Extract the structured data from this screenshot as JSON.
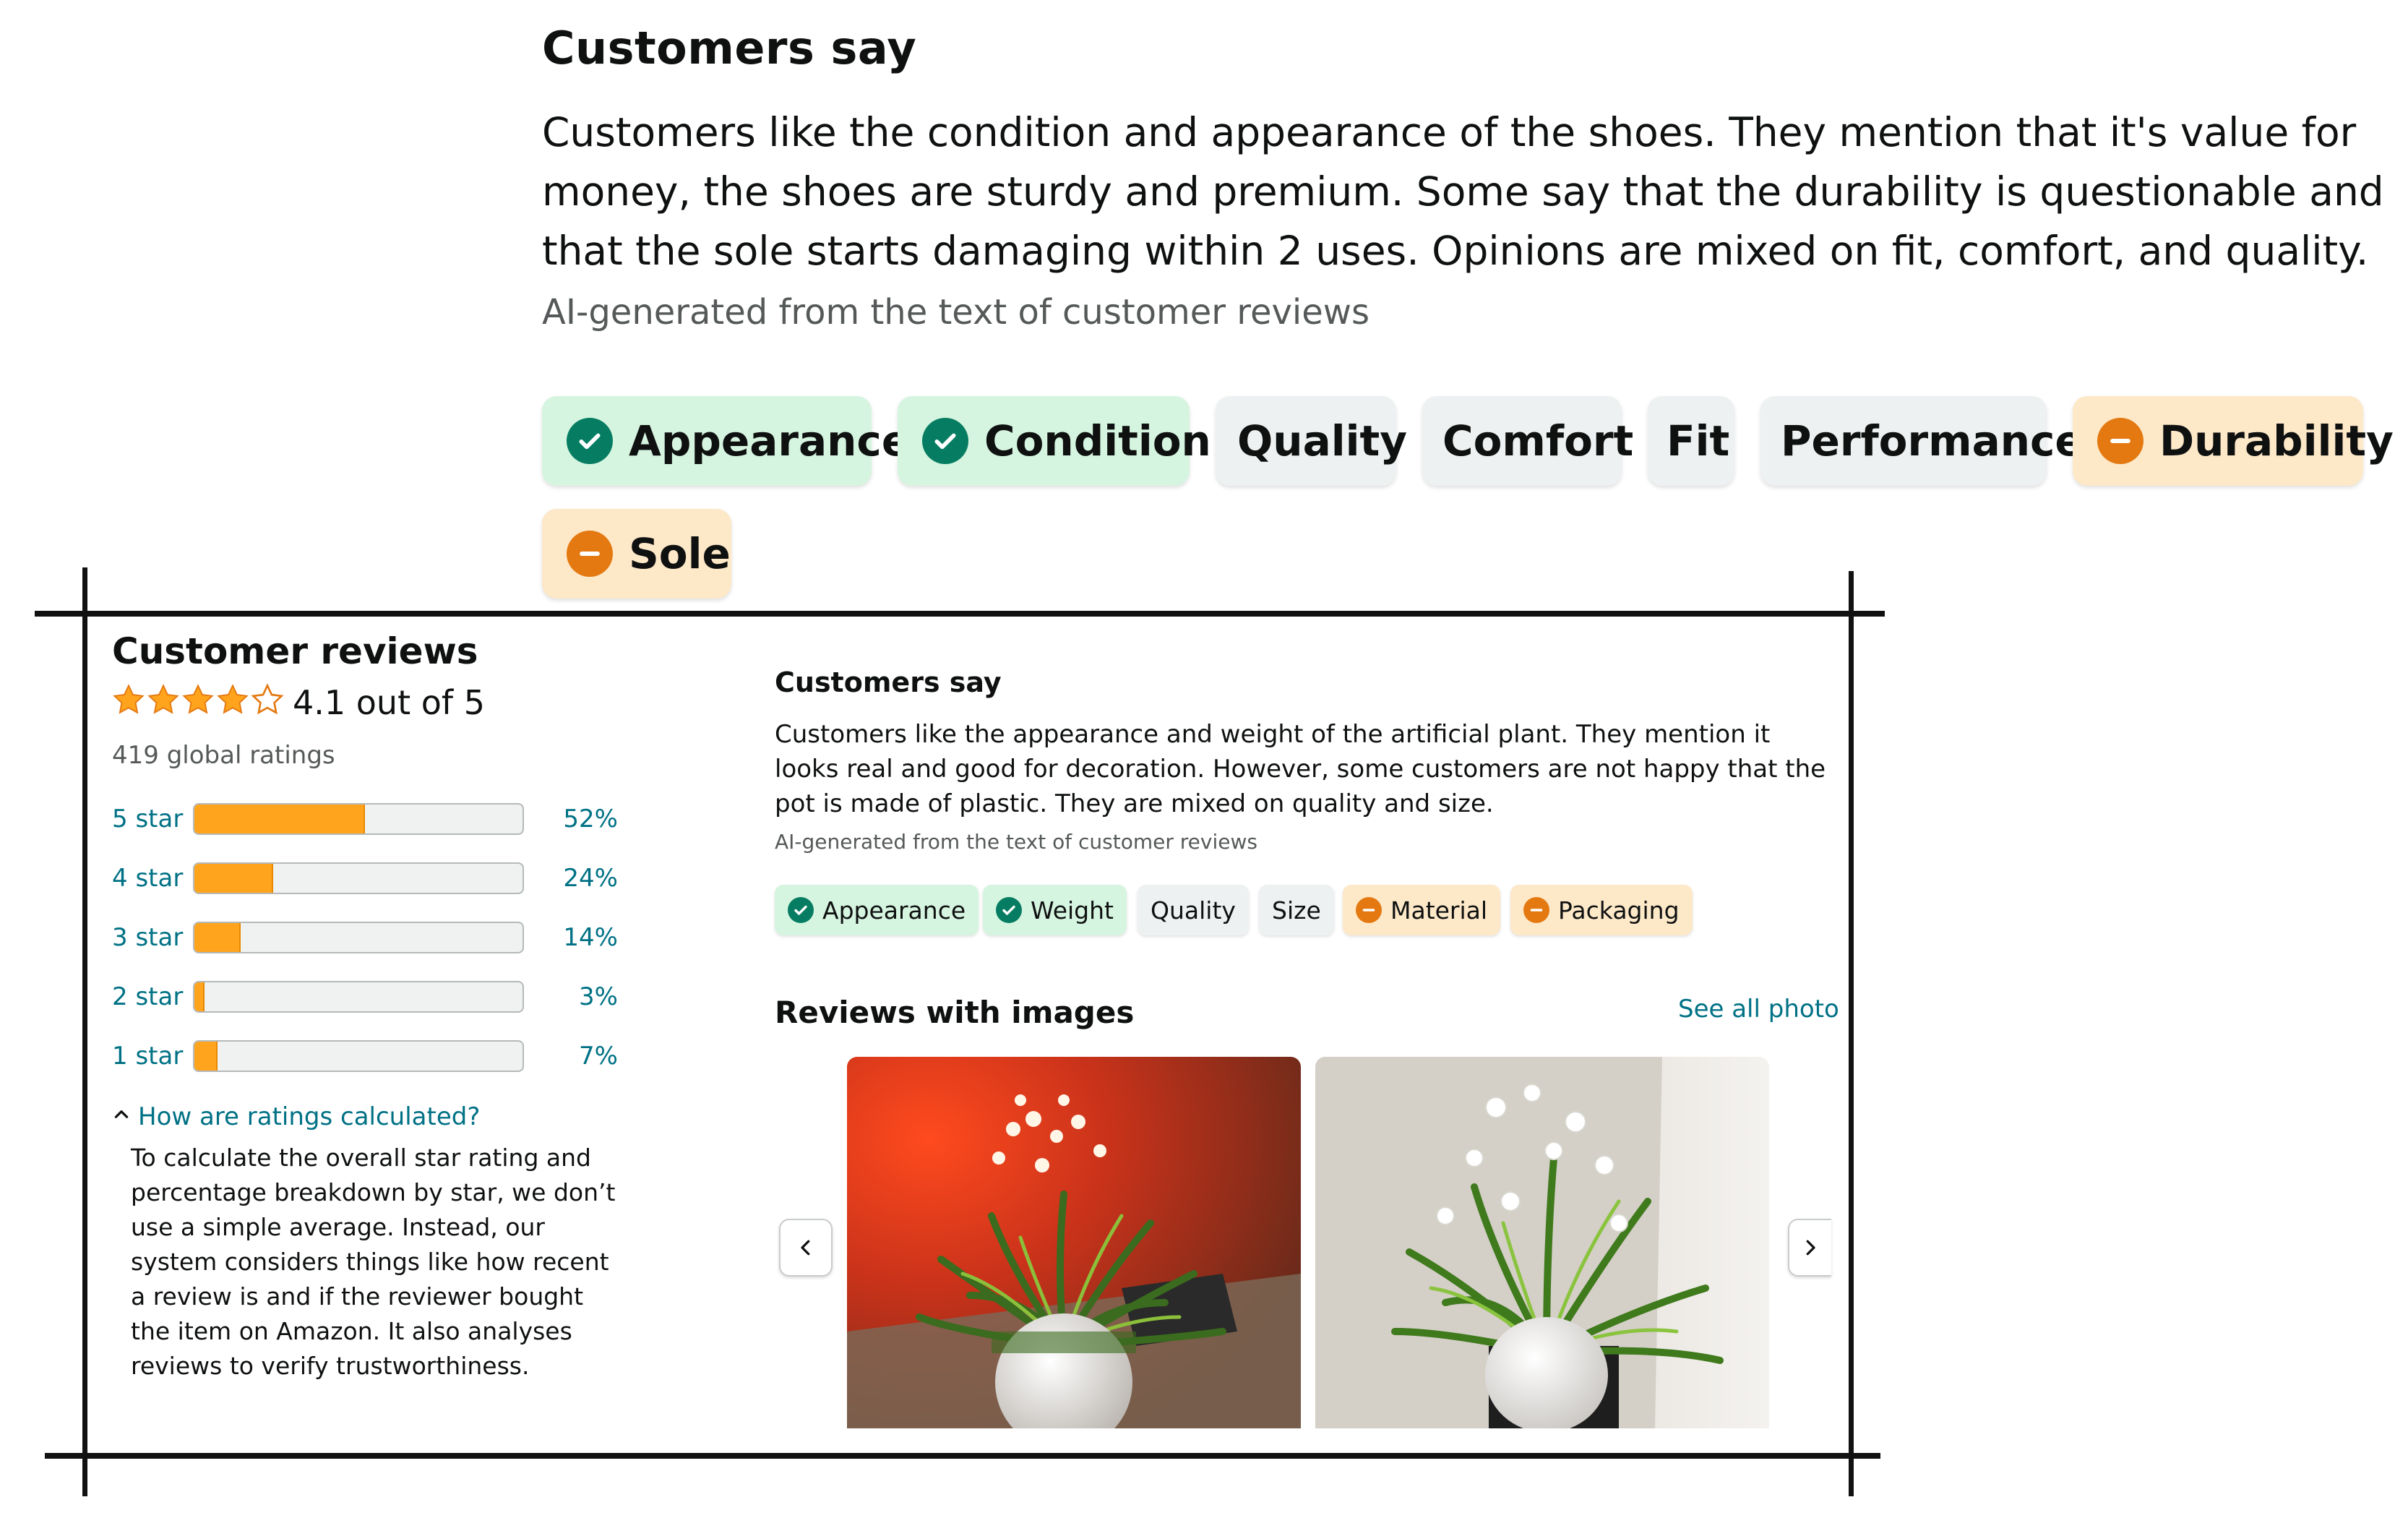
{
  "top": {
    "title": "Customers say",
    "summary": "Customers like the condition and appearance of the shoes. They mention that it's value for money, the shoes are sturdy and premium. Some say that the durability is questionable and that the sole starts damaging within 2 uses. Opinions are mixed on fit, comfort, and quality.",
    "ai_note": "AI-generated from the text of customer reviews",
    "chips": [
      {
        "label": "Appearance",
        "sentiment": "positive",
        "icon": "check-circle-icon"
      },
      {
        "label": "Condition",
        "sentiment": "positive",
        "icon": "check-circle-icon"
      },
      {
        "label": "Quality",
        "sentiment": "neutral"
      },
      {
        "label": "Comfort",
        "sentiment": "neutral"
      },
      {
        "label": "Fit",
        "sentiment": "neutral"
      },
      {
        "label": "Performance",
        "sentiment": "neutral"
      },
      {
        "label": "Durability",
        "sentiment": "negative",
        "icon": "minus-circle-icon"
      },
      {
        "label": "Sole",
        "sentiment": "negative",
        "icon": "minus-circle-icon"
      }
    ]
  },
  "reviews": {
    "title": "Customer reviews",
    "stars_value": 4.1,
    "rating_text": "4.1 out of 5",
    "global_ratings": "419 global ratings",
    "histogram": [
      {
        "label": "5 star",
        "pct_text": "52%",
        "pct": 52
      },
      {
        "label": "4 star",
        "pct_text": "24%",
        "pct": 24
      },
      {
        "label": "3 star",
        "pct_text": "14%",
        "pct": 14
      },
      {
        "label": "2 star",
        "pct_text": "3%",
        "pct": 3
      },
      {
        "label": "1 star",
        "pct_text": "7%",
        "pct": 7
      }
    ],
    "how_link": "How are ratings calculated?",
    "explanation": "To calculate the overall star rating and percentage breakdown by star, we don’t use a simple average. Instead, our system considers things like how recent a review is and if the reviewer bought the item on Amazon. It also analyses reviews to verify trustworthiness."
  },
  "customers_say": {
    "title": "Customers say",
    "summary": "Customers like the appearance and weight of the artificial plant. They mention it looks real and good for decoration. However, some customers are not happy that the pot is made of plastic. They are mixed on quality and size.",
    "ai_note": "AI-generated from the text of customer reviews",
    "chips": [
      {
        "label": "Appearance",
        "sentiment": "positive",
        "icon": "check-circle-icon"
      },
      {
        "label": "Weight",
        "sentiment": "positive",
        "icon": "check-circle-icon"
      },
      {
        "label": "Quality",
        "sentiment": "neutral"
      },
      {
        "label": "Size",
        "sentiment": "neutral"
      },
      {
        "label": "Material",
        "sentiment": "negative",
        "icon": "minus-circle-icon"
      },
      {
        "label": "Packaging",
        "sentiment": "negative",
        "icon": "minus-circle-icon"
      }
    ]
  },
  "images_section": {
    "title": "Reviews with images",
    "see_all": "See all photo"
  },
  "colors": {
    "positive_bg": "#d6f5e0",
    "positive_icon": "#067d62",
    "negative_bg": "#fde8c8",
    "negative_icon": "#e47911",
    "neutral_bg": "#eef1f1",
    "star": "#ffa41c",
    "link": "#007185"
  }
}
